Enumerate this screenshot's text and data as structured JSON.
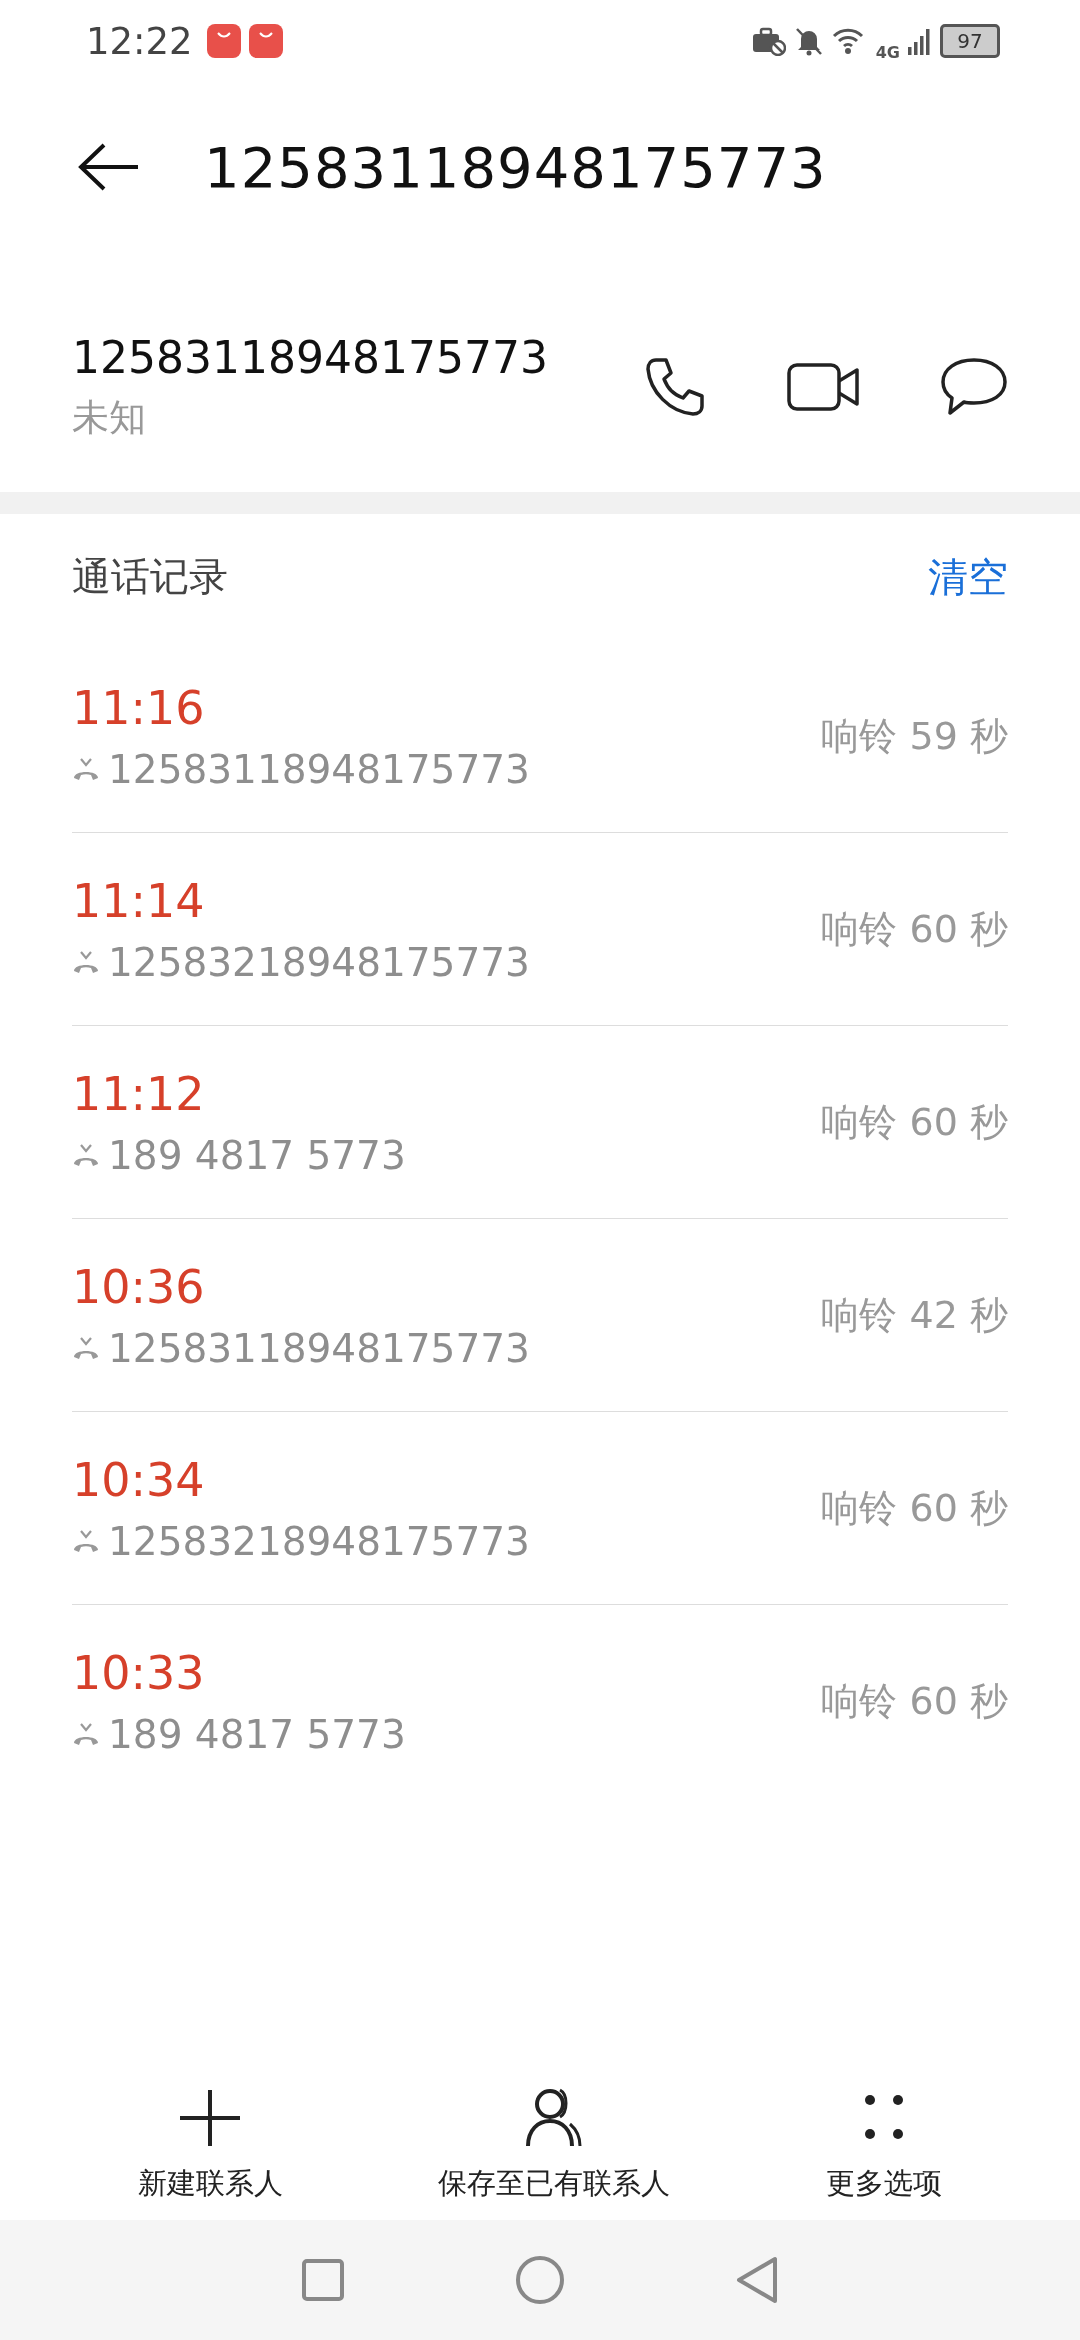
{
  "status_bar": {
    "time": "12:22",
    "network": "4G",
    "battery": "97"
  },
  "header": {
    "title": "12583118948175773"
  },
  "contact": {
    "number": "12583118948175773",
    "label": "未知"
  },
  "history": {
    "title": "通话记录",
    "clear": "清空",
    "calls": [
      {
        "time": "11:16",
        "number": "12583118948175773",
        "duration": "响铃 59 秒",
        "missed": true
      },
      {
        "time": "11:14",
        "number": "12583218948175773",
        "duration": "响铃 60 秒",
        "missed": true
      },
      {
        "time": "11:12",
        "number": "189 4817 5773",
        "duration": "响铃 60 秒",
        "missed": true
      },
      {
        "time": "10:36",
        "number": "12583118948175773",
        "duration": "响铃 42 秒",
        "missed": true
      },
      {
        "time": "10:34",
        "number": "12583218948175773",
        "duration": "响铃 60 秒",
        "missed": true
      },
      {
        "time": "10:33",
        "number": "189 4817 5773",
        "duration": "响铃 60 秒",
        "missed": true
      }
    ]
  },
  "actions": [
    {
      "kind": "add",
      "label": "新建联系人"
    },
    {
      "kind": "person",
      "label": "保存至已有联系人"
    },
    {
      "kind": "more",
      "label": "更多选项"
    }
  ]
}
